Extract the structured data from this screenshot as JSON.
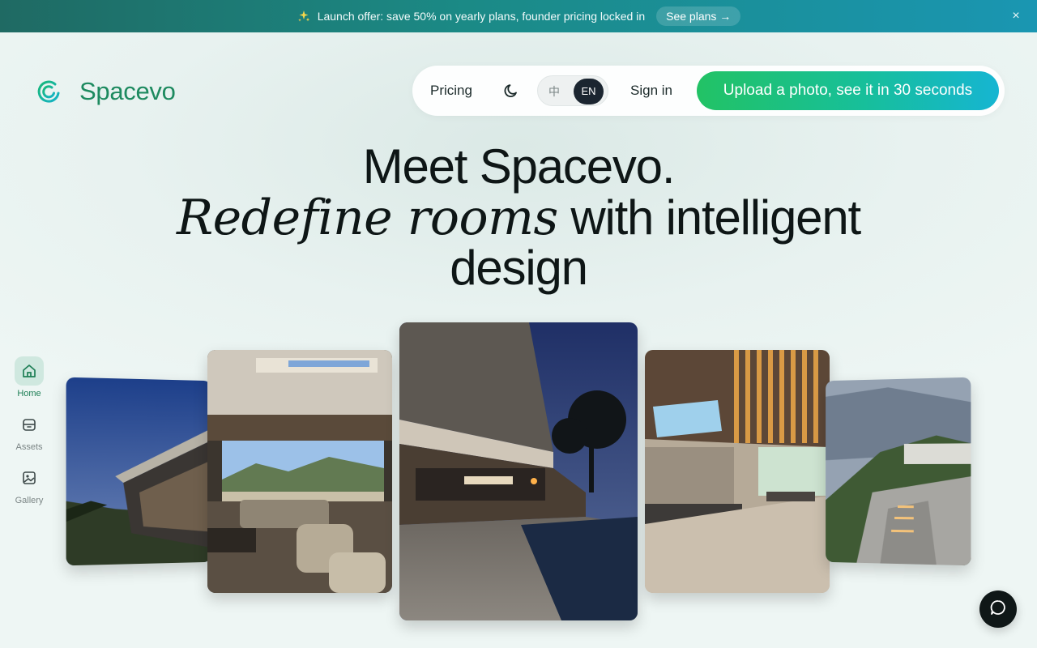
{
  "announcement": {
    "icon": "sparkles-icon",
    "text": "Launch offer: save 50% on yearly plans, founder pricing locked in",
    "cta_label": "See plans →",
    "close_glyph": "×"
  },
  "brand": {
    "name": "Spacevo",
    "color": "#1d8a5f"
  },
  "nav": {
    "pricing": "Pricing",
    "theme_icon": "moon-icon",
    "lang_zh": "中",
    "lang_en": "EN",
    "signin": "Sign in",
    "upload_cta": "Upload a photo, see it in 30 seconds"
  },
  "hero": {
    "line1": "Meet Spacevo.",
    "line2_italic": "Redefine rooms",
    "line2_rest": "with intelligent",
    "line3": "design"
  },
  "sidebar": {
    "items": [
      {
        "label": "Home",
        "icon": "home-icon",
        "active": true
      },
      {
        "label": "Assets",
        "icon": "archive-icon",
        "active": false
      },
      {
        "label": "Gallery",
        "icon": "image-icon",
        "active": false
      }
    ]
  },
  "gallery": {
    "cards": [
      {
        "name": "modern-villa-dusk-exterior"
      },
      {
        "name": "living-room-mountain-view"
      },
      {
        "name": "villa-pool-night"
      },
      {
        "name": "open-plan-interior-skylight"
      },
      {
        "name": "hillside-villa-pathway"
      }
    ]
  },
  "colors": {
    "accent_green": "#22c265",
    "accent_cyan": "#16b5d2",
    "dark": "#1b2530"
  }
}
